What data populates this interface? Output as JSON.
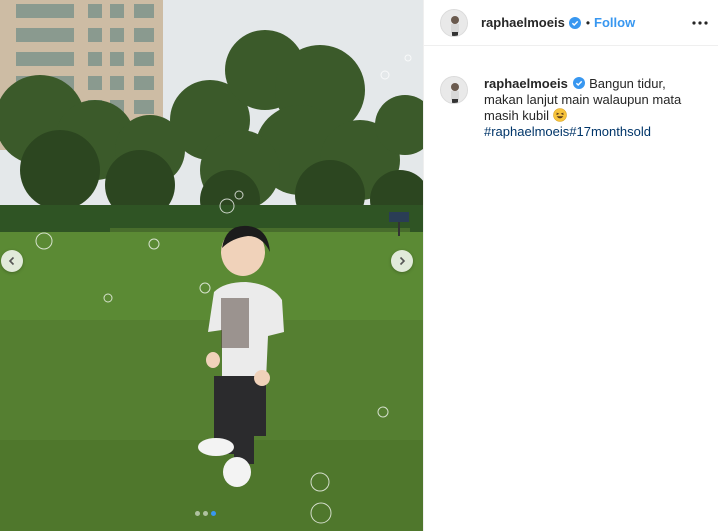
{
  "post": {
    "username": "raphaelmoeis",
    "follow_label": "Follow",
    "separator": "•",
    "carousel": {
      "slide_count": 3,
      "active_slide": 2
    }
  },
  "caption": {
    "username": "raphaelmoeis",
    "text": "Bangun tidur, makan lanjut main walaupun mata masih kubil",
    "emoji": "grinning-squinting-face",
    "hashtags": [
      "#raphaelmoeis",
      "#17monthsold"
    ]
  },
  "colors": {
    "link_blue": "#3897f0",
    "hashtag_blue": "#003569",
    "text_dark": "#262626"
  }
}
